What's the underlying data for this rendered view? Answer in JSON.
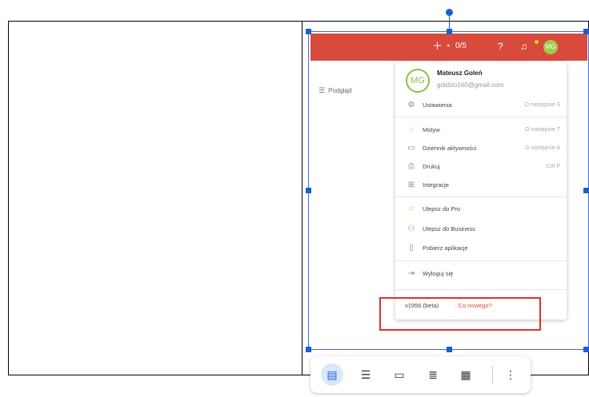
{
  "topbar": {
    "add_icon": "plus-icon",
    "karma_icon": "karma-icon",
    "karma_value": "0/5",
    "help_icon": "help-icon",
    "bell_icon": "bell-icon",
    "avatar_initials": "MG"
  },
  "sidebar": {
    "view_label": "Podgląd"
  },
  "menu": {
    "name": "Mateusz Goleń",
    "email": "goldzio160@gmail.com",
    "avatar_initials": "MG",
    "items": [
      {
        "label": "Ustawienia",
        "shortcut": "O następnie S",
        "icon": "gear-icon"
      },
      {
        "label": "Motyw",
        "shortcut": "O następnie T",
        "icon": "theme-icon"
      },
      {
        "label": "Dziennik aktywności",
        "shortcut": "G następnie A",
        "icon": "activity-icon"
      },
      {
        "label": "Drukuj",
        "shortcut": "Ctrl P",
        "icon": "print-icon"
      },
      {
        "label": "Integracje",
        "shortcut": "",
        "icon": "integrations-icon"
      },
      {
        "label": "Ulepsz do Pro",
        "shortcut": "",
        "icon": "star-icon"
      },
      {
        "label": "Ulepsz do Business",
        "shortcut": "",
        "icon": "team-icon"
      },
      {
        "label": "Pobierz aplikacje",
        "shortcut": "",
        "icon": "mobile-icon"
      },
      {
        "label": "Wyloguj się",
        "shortcut": "",
        "icon": "logout-icon"
      }
    ],
    "version": "v1956 (beta)",
    "whats_new": "· Co nowego?"
  },
  "colors": {
    "brand": "#d84a3b",
    "selection": "#1a5fd0",
    "highlight": "#e0302a"
  },
  "toolbar": {
    "buttons": [
      "inline-icon",
      "wrap-text-icon",
      "break-text-icon",
      "behind-text-icon",
      "in-front-text-icon"
    ],
    "more": "⋮"
  }
}
